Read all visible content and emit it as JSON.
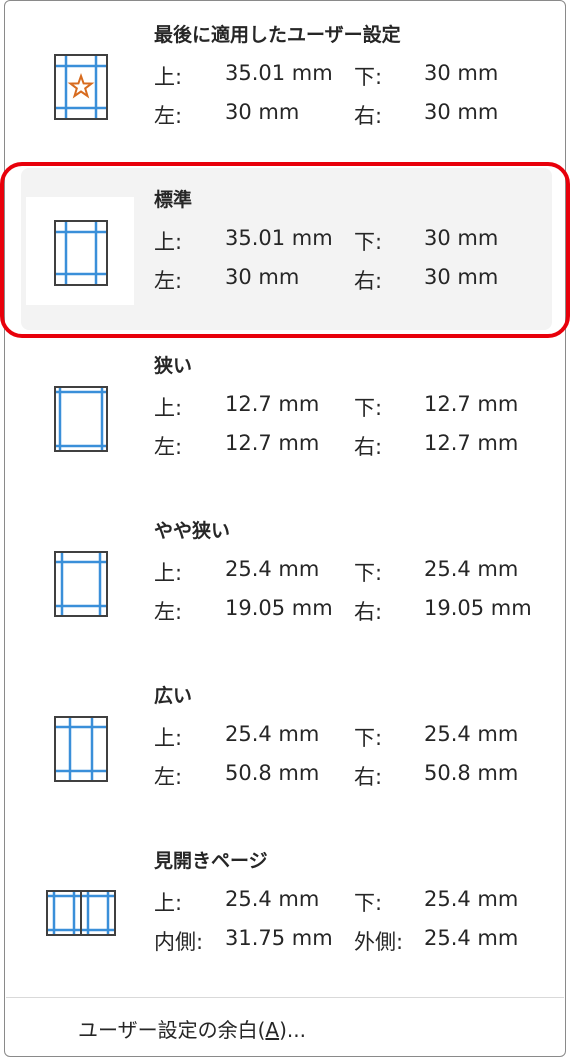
{
  "presets": [
    {
      "title": "最後に適用したユーザー設定",
      "r1": {
        "l1": "上:",
        "v1": "35.01 mm",
        "l2": "下:",
        "v2": "30 mm"
      },
      "r2": {
        "l1": "左:",
        "v1": "30 mm",
        "l2": "右:",
        "v2": "30 mm"
      }
    },
    {
      "title": "標準",
      "r1": {
        "l1": "上:",
        "v1": "35.01 mm",
        "l2": "下:",
        "v2": "30 mm"
      },
      "r2": {
        "l1": "左:",
        "v1": "30 mm",
        "l2": "右:",
        "v2": "30 mm"
      }
    },
    {
      "title": "狭い",
      "r1": {
        "l1": "上:",
        "v1": "12.7 mm",
        "l2": "下:",
        "v2": "12.7 mm"
      },
      "r2": {
        "l1": "左:",
        "v1": "12.7 mm",
        "l2": "右:",
        "v2": "12.7 mm"
      }
    },
    {
      "title": "やや狭い",
      "r1": {
        "l1": "上:",
        "v1": "25.4 mm",
        "l2": "下:",
        "v2": "25.4 mm"
      },
      "r2": {
        "l1": "左:",
        "v1": "19.05 mm",
        "l2": "右:",
        "v2": "19.05 mm"
      }
    },
    {
      "title": "広い",
      "r1": {
        "l1": "上:",
        "v1": "25.4 mm",
        "l2": "下:",
        "v2": "25.4 mm"
      },
      "r2": {
        "l1": "左:",
        "v1": "50.8 mm",
        "l2": "右:",
        "v2": "50.8 mm"
      }
    },
    {
      "title": "見開きページ",
      "r1": {
        "l1": "上:",
        "v1": "25.4 mm",
        "l2": "下:",
        "v2": "25.4 mm"
      },
      "r2": {
        "l1": "内側:",
        "v1": "31.75 mm",
        "l2": "外側:",
        "v2": "25.4 mm"
      }
    }
  ],
  "custom_margins": {
    "label": "ユーザー設定の余白(A)...",
    "access_key": "A"
  },
  "colors": {
    "guide_line": "#3a8fd9",
    "page_border": "#404040",
    "star": "#d76b1f",
    "highlight": "#f3f3f3",
    "callout": "#e8000b"
  },
  "icons": [
    "custom-margin-page-icon",
    "normal-margin-page-icon",
    "narrow-margin-page-icon",
    "moderate-margin-page-icon",
    "wide-margin-page-icon",
    "mirrored-margin-pages-icon"
  ]
}
